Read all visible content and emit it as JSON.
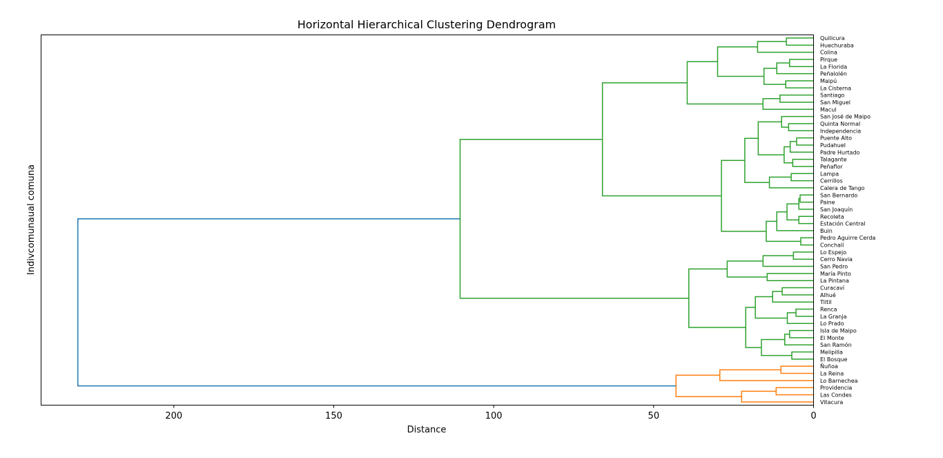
{
  "chart_data": {
    "type": "dendrogram",
    "orientation": "horizontal",
    "title": "Horizontal Hierarchical Clustering Dendrogram",
    "xlabel": "Distance",
    "ylabel": "Indivcomunaual comuna",
    "xlim": [
      241.5,
      0
    ],
    "xticks": [
      200,
      150,
      100,
      50,
      0
    ],
    "colors": {
      "green": "#2ca02c",
      "orange": "#ff7f0e",
      "blue": "#1f77b4"
    },
    "leaves": [
      "Quilicura",
      "Huechuraba",
      "Colina",
      "Pirque",
      "La Florida",
      "Peñalolén",
      "Maipú",
      "La Cisterna",
      "Santiago",
      "San Miguel",
      "Macul",
      "San José de Maipo",
      "Quinta Normal",
      "Independencia",
      "Puente Alto",
      "Pudahuel",
      "Padre Hurtado",
      "Talagante",
      "Peñaflor",
      "Lampa",
      "Cerrillos",
      "Calera de Tango",
      "San Bernardo",
      "Paine",
      "San Joaquín",
      "Recoleta",
      "Estación Central",
      "Buin",
      "Pedro Aguirre Cerda",
      "Conchalí",
      "Lo Espejo",
      "Cerro Navia",
      "San Pedro",
      "María Pinto",
      "La Pintana",
      "Curacaví",
      "Alhué",
      "Tiltil",
      "Renca",
      "La Granja",
      "Lo Prado",
      "Isla de Maipo",
      "El Monte",
      "San Ramón",
      "Melipilla",
      "El Bosque",
      "Ñuñoa",
      "La Reina",
      "Lo Barnechea",
      "Providencia",
      "Las Condes",
      "Vitacura"
    ],
    "links": [
      {
        "a": "L0",
        "b": "L1",
        "d": 8.5,
        "c": "green"
      },
      {
        "a": "L0+1",
        "b": "L2",
        "d": 17.5,
        "c": "green"
      },
      {
        "a": "L3",
        "b": "L4",
        "d": 7.5,
        "c": "green"
      },
      {
        "a": "L3+4",
        "b": "L5",
        "d": 11.5,
        "c": "green"
      },
      {
        "a": "L6",
        "b": "L7",
        "d": 8.7,
        "c": "green"
      },
      {
        "a": "L3-5",
        "b": "L6-7",
        "d": 15.5,
        "c": "green"
      },
      {
        "a": "L0-2",
        "b": "L3-7",
        "d": 30.0,
        "c": "green"
      },
      {
        "a": "L8",
        "b": "L9",
        "d": 10.5,
        "c": "green"
      },
      {
        "a": "L8+9",
        "b": "L10",
        "d": 15.8,
        "c": "green"
      },
      {
        "a": "L0-7",
        "b": "L8-10",
        "d": 39.5,
        "c": "green"
      },
      {
        "a": "L12",
        "b": "L13",
        "d": 7.8,
        "c": "green"
      },
      {
        "a": "L11",
        "b": "L12-13",
        "d": 10.0,
        "c": "green"
      },
      {
        "a": "L14",
        "b": "L15",
        "d": 5.3,
        "c": "green"
      },
      {
        "a": "L14+15",
        "b": "L16",
        "d": 7.3,
        "c": "green"
      },
      {
        "a": "L17",
        "b": "L18",
        "d": 6.5,
        "c": "green"
      },
      {
        "a": "L14-16",
        "b": "L17-18",
        "d": 9.2,
        "c": "green"
      },
      {
        "a": "L11-13",
        "b": "L14-18",
        "d": 17.3,
        "c": "green"
      },
      {
        "a": "L19",
        "b": "L20",
        "d": 7.0,
        "c": "green"
      },
      {
        "a": "L19+20",
        "b": "L21",
        "d": 13.8,
        "c": "green"
      },
      {
        "a": "L11-18",
        "b": "L19-21",
        "d": 21.5,
        "c": "green"
      },
      {
        "a": "L22",
        "b": "L23",
        "d": 4.2,
        "c": "green"
      },
      {
        "a": "L22+23",
        "b": "L24",
        "d": 4.6,
        "c": "green"
      },
      {
        "a": "L25",
        "b": "L26",
        "d": 4.6,
        "c": "green"
      },
      {
        "a": "L22-24",
        "b": "L25-26",
        "d": 8.3,
        "c": "green"
      },
      {
        "a": "L22-26",
        "b": "L27",
        "d": 11.5,
        "c": "green"
      },
      {
        "a": "L28",
        "b": "L29",
        "d": 4.0,
        "c": "green"
      },
      {
        "a": "L22-27",
        "b": "L28-29",
        "d": 14.8,
        "c": "green"
      },
      {
        "a": "L11-21",
        "b": "L22-29",
        "d": 28.8,
        "c": "green"
      },
      {
        "a": "L0-10",
        "b": "L11-29",
        "d": 66.0,
        "c": "green"
      },
      {
        "a": "L30",
        "b": "L31",
        "d": 6.3,
        "c": "green"
      },
      {
        "a": "L30+31",
        "b": "L32",
        "d": 15.8,
        "c": "green"
      },
      {
        "a": "L33",
        "b": "L34",
        "d": 14.5,
        "c": "green"
      },
      {
        "a": "L30-32",
        "b": "L33-34",
        "d": 27.0,
        "c": "green"
      },
      {
        "a": "L35",
        "b": "L36",
        "d": 9.8,
        "c": "green"
      },
      {
        "a": "L35+36",
        "b": "L37",
        "d": 12.8,
        "c": "green"
      },
      {
        "a": "L38",
        "b": "L39",
        "d": 5.5,
        "c": "green"
      },
      {
        "a": "L38+39",
        "b": "L40",
        "d": 8.2,
        "c": "green"
      },
      {
        "a": "L35-37",
        "b": "L38-40",
        "d": 18.2,
        "c": "green"
      },
      {
        "a": "L41",
        "b": "L42",
        "d": 7.5,
        "c": "green"
      },
      {
        "a": "L41+42",
        "b": "L43",
        "d": 9.0,
        "c": "green"
      },
      {
        "a": "L44",
        "b": "L45",
        "d": 6.8,
        "c": "green"
      },
      {
        "a": "L41-43",
        "b": "L44-45",
        "d": 16.3,
        "c": "green"
      },
      {
        "a": "L35-40",
        "b": "L41-45",
        "d": 21.2,
        "c": "green"
      },
      {
        "a": "L30-34",
        "b": "L35-45",
        "d": 39.0,
        "c": "green"
      },
      {
        "a": "L0-29",
        "b": "L30-45",
        "d": 110.5,
        "c": "green"
      },
      {
        "a": "L46",
        "b": "L47",
        "d": 10.2,
        "c": "orange"
      },
      {
        "a": "L46+47",
        "b": "L48",
        "d": 29.3,
        "c": "orange"
      },
      {
        "a": "L49",
        "b": "L50",
        "d": 11.7,
        "c": "orange"
      },
      {
        "a": "L49+50",
        "b": "L51",
        "d": 22.5,
        "c": "orange"
      },
      {
        "a": "L46-48",
        "b": "L49-51",
        "d": 43.0,
        "c": "orange"
      },
      {
        "a": "L0-45",
        "b": "L46-51",
        "d": 230.0,
        "c": "blue"
      }
    ]
  }
}
